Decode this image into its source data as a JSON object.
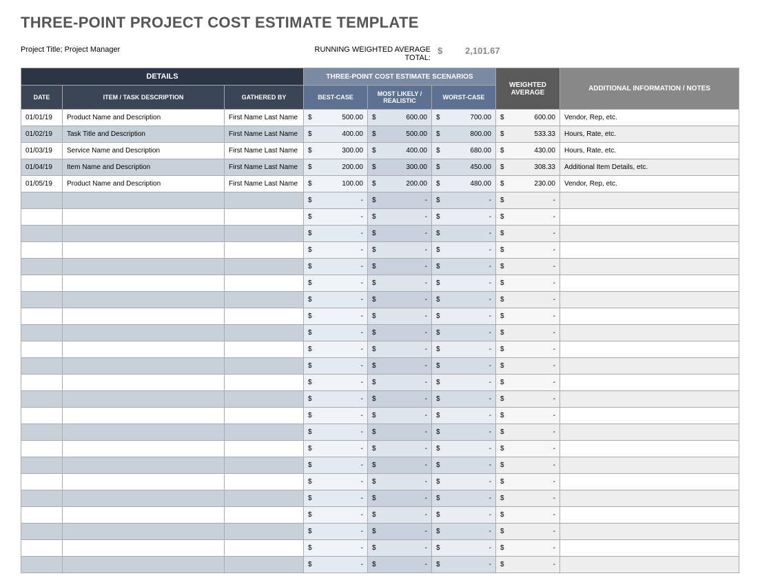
{
  "title": "THREE-POINT PROJECT COST ESTIMATE TEMPLATE",
  "project_label": "Project Title; Project Manager",
  "running_label": "RUNNING WEIGHTED AVERAGE TOTAL:",
  "running_dollar": "$",
  "running_total": "2,101.67",
  "headers": {
    "details": "DETAILS",
    "scenarios": "THREE-POINT COST ESTIMATE SCENARIOS",
    "weighted": "WEIGHTED AVERAGE",
    "notes": "ADDITIONAL INFORMATION / NOTES",
    "date": "DATE",
    "item": "ITEM / TASK DESCRIPTION",
    "gathered": "GATHERED BY",
    "best": "BEST-CASE",
    "likely": "MOST LIKELY / REALISTIC",
    "worst": "WORST-CASE"
  },
  "rows": [
    {
      "date": "01/01/19",
      "item": "Product Name and Description",
      "gathered": "First Name Last Name",
      "best": "500.00",
      "likely": "600.00",
      "worst": "700.00",
      "weighted": "600.00",
      "notes": "Vendor, Rep, etc."
    },
    {
      "date": "01/02/19",
      "item": "Task Title and Description",
      "gathered": "First Name Last Name",
      "best": "400.00",
      "likely": "500.00",
      "worst": "800.00",
      "weighted": "533.33",
      "notes": "Hours, Rate, etc."
    },
    {
      "date": "01/03/19",
      "item": "Service Name and Description",
      "gathered": "First Name Last Name",
      "best": "300.00",
      "likely": "400.00",
      "worst": "680.00",
      "weighted": "430.00",
      "notes": "Hours, Rate, etc."
    },
    {
      "date": "01/04/19",
      "item": "Item Name and Description",
      "gathered": "First Name Last Name",
      "best": "200.00",
      "likely": "300.00",
      "worst": "450.00",
      "weighted": "308.33",
      "notes": "Additional Item Details, etc."
    },
    {
      "date": "01/05/19",
      "item": "Product Name and Description",
      "gathered": "First Name Last Name",
      "best": "100.00",
      "likely": "200.00",
      "worst": "480.00",
      "weighted": "230.00",
      "notes": "Vendor, Rep, etc."
    }
  ],
  "empty_row_count": 23,
  "dash": "-",
  "dollar": "$"
}
